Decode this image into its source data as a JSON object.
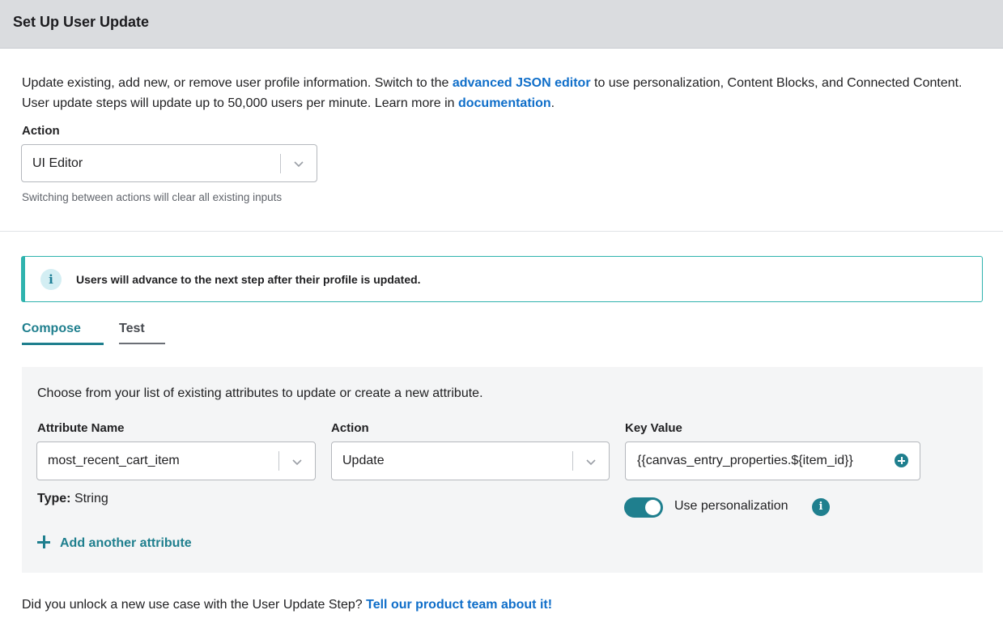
{
  "header": {
    "title": "Set Up User Update"
  },
  "intro": {
    "text_1": "Update existing, add new, or remove user profile information. Switch to the ",
    "link_json": "advanced JSON editor",
    "text_2": " to use personalization, Content Blocks, and Connected Content. User update steps will update up to 50,000 users per minute. Learn more in ",
    "link_docs": "documentation",
    "text_3": "."
  },
  "action_select": {
    "label": "Action",
    "value": "UI Editor",
    "hint": "Switching between actions will clear all existing inputs"
  },
  "banner": {
    "icon": "info-icon",
    "message": "Users will advance to the next step after their profile is updated."
  },
  "tabs": [
    {
      "label": "Compose",
      "active": true
    },
    {
      "label": "Test",
      "active": false
    }
  ],
  "compose": {
    "lead": "Choose from your list of existing attributes to update or create a new attribute.",
    "attribute_name": {
      "label": "Attribute Name",
      "value": "most_recent_cart_item"
    },
    "action": {
      "label": "Action",
      "value": "Update"
    },
    "key_value": {
      "label": "Key Value",
      "value": "{{canvas_entry_properties.${item_id}}"
    },
    "type_label": "Type:",
    "type_value": "String",
    "personalization": {
      "label": "Use personalization",
      "enabled": true
    },
    "add_attribute": "Add another attribute"
  },
  "footer": {
    "text": "Did you unlock a new use case with the User Update Step? ",
    "link": "Tell our product team about it!"
  },
  "colors": {
    "accent": "#1f7f8e",
    "link": "#0f6ec9",
    "banner_border": "#2fb3ae",
    "header_bg": "#dadcdf"
  }
}
